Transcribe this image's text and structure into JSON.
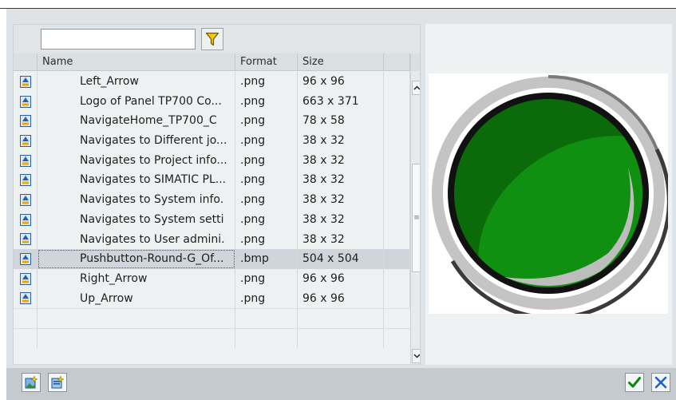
{
  "search": {
    "value": "",
    "placeholder": ""
  },
  "table": {
    "columns": [
      "Name",
      "Format",
      "Size"
    ],
    "rows": [
      {
        "name": "Left_Arrow",
        "format": ".png",
        "size": "96 x 96"
      },
      {
        "name": "Logo of Panel TP700 Co...",
        "format": ".png",
        "size": "663 x 371"
      },
      {
        "name": "NavigateHome_TP700_C",
        "format": ".png",
        "size": "78 x 58"
      },
      {
        "name": "Navigates to Different jo...",
        "format": ".png",
        "size": "38 x 32"
      },
      {
        "name": "Navigates to Project info...",
        "format": ".png",
        "size": "38 x 32"
      },
      {
        "name": "Navigates to SIMATIC PL...",
        "format": ".png",
        "size": "38 x 32"
      },
      {
        "name": "Navigates to System info.",
        "format": ".png",
        "size": "38 x 32"
      },
      {
        "name": "Navigates to System setti",
        "format": ".png",
        "size": "38 x 32"
      },
      {
        "name": "Navigates to User admini.",
        "format": ".png",
        "size": "38 x 32"
      },
      {
        "name": "Pushbutton-Round-G_Of...",
        "format": ".bmp",
        "size": "504 x 504",
        "selected": true
      },
      {
        "name": "Right_Arrow",
        "format": ".png",
        "size": "96 x 96"
      },
      {
        "name": "Up_Arrow",
        "format": ".png",
        "size": "96 x 96"
      }
    ]
  },
  "scrollbar": {
    "thumb_glyph": "≡"
  },
  "preview": {
    "description_icon": "green-round-pushbutton-icon"
  },
  "toolbar": {
    "left_icons": [
      "add-graphic-icon",
      "add-graphic-from-file-icon"
    ],
    "ok_icon": "checkmark-icon",
    "cancel_icon": "close-icon"
  },
  "colors": {
    "accent_green": "#0a8a0a",
    "cancel_blue": "#1f5fd0",
    "row_selected": "#cfd5da"
  }
}
